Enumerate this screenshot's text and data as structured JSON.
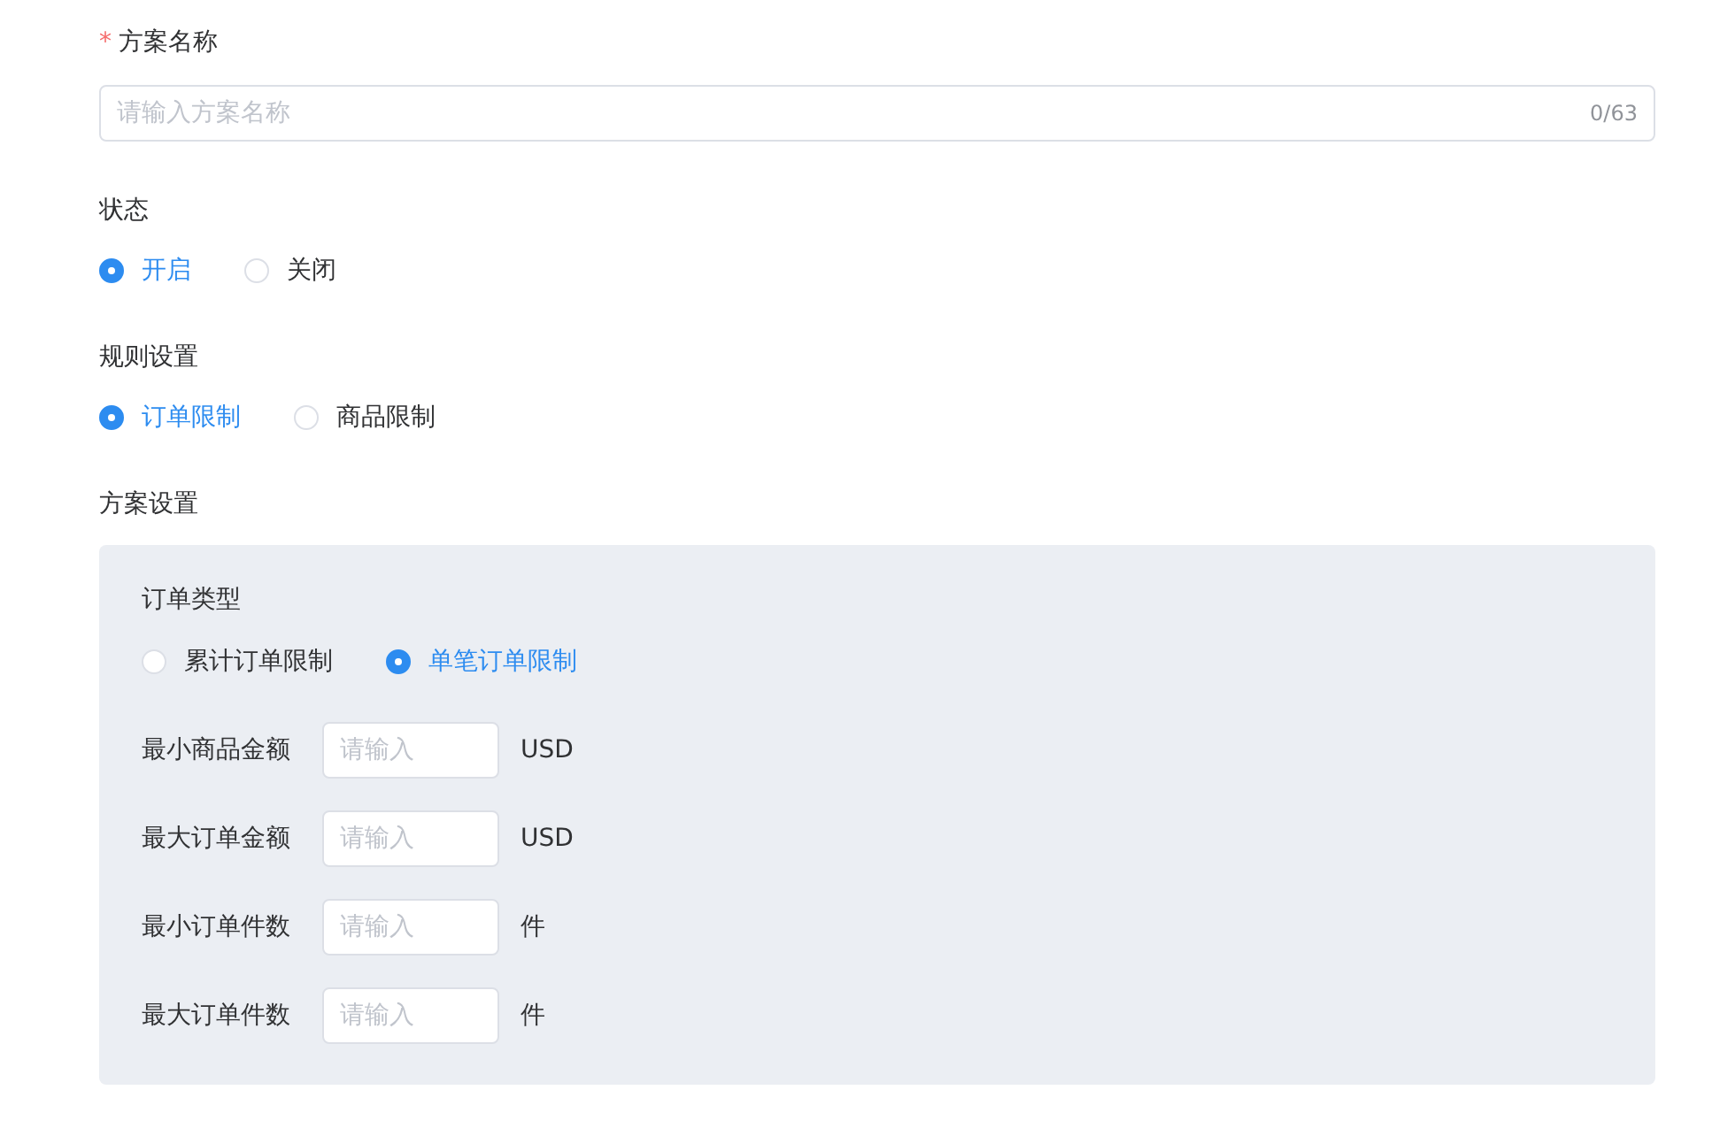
{
  "plan_name": {
    "required_mark": "*",
    "label": "方案名称",
    "placeholder": "请输入方案名称",
    "counter": "0/63"
  },
  "status": {
    "label": "状态",
    "options": [
      {
        "label": "开启",
        "selected": true
      },
      {
        "label": "关闭",
        "selected": false
      }
    ]
  },
  "rule_settings": {
    "label": "规则设置",
    "options": [
      {
        "label": "订单限制",
        "selected": true
      },
      {
        "label": "商品限制",
        "selected": false
      }
    ]
  },
  "plan_settings": {
    "label": "方案设置",
    "order_type": {
      "label": "订单类型",
      "options": [
        {
          "label": "累计订单限制",
          "selected": false
        },
        {
          "label": "单笔订单限制",
          "selected": true
        }
      ]
    },
    "fields": [
      {
        "label": "最小商品金额",
        "placeholder": "请输入",
        "unit": "USD"
      },
      {
        "label": "最大订单金额",
        "placeholder": "请输入",
        "unit": "USD"
      },
      {
        "label": "最小订单件数",
        "placeholder": "请输入",
        "unit": "件"
      },
      {
        "label": "最大订单件数",
        "placeholder": "请输入",
        "unit": "件"
      }
    ]
  }
}
